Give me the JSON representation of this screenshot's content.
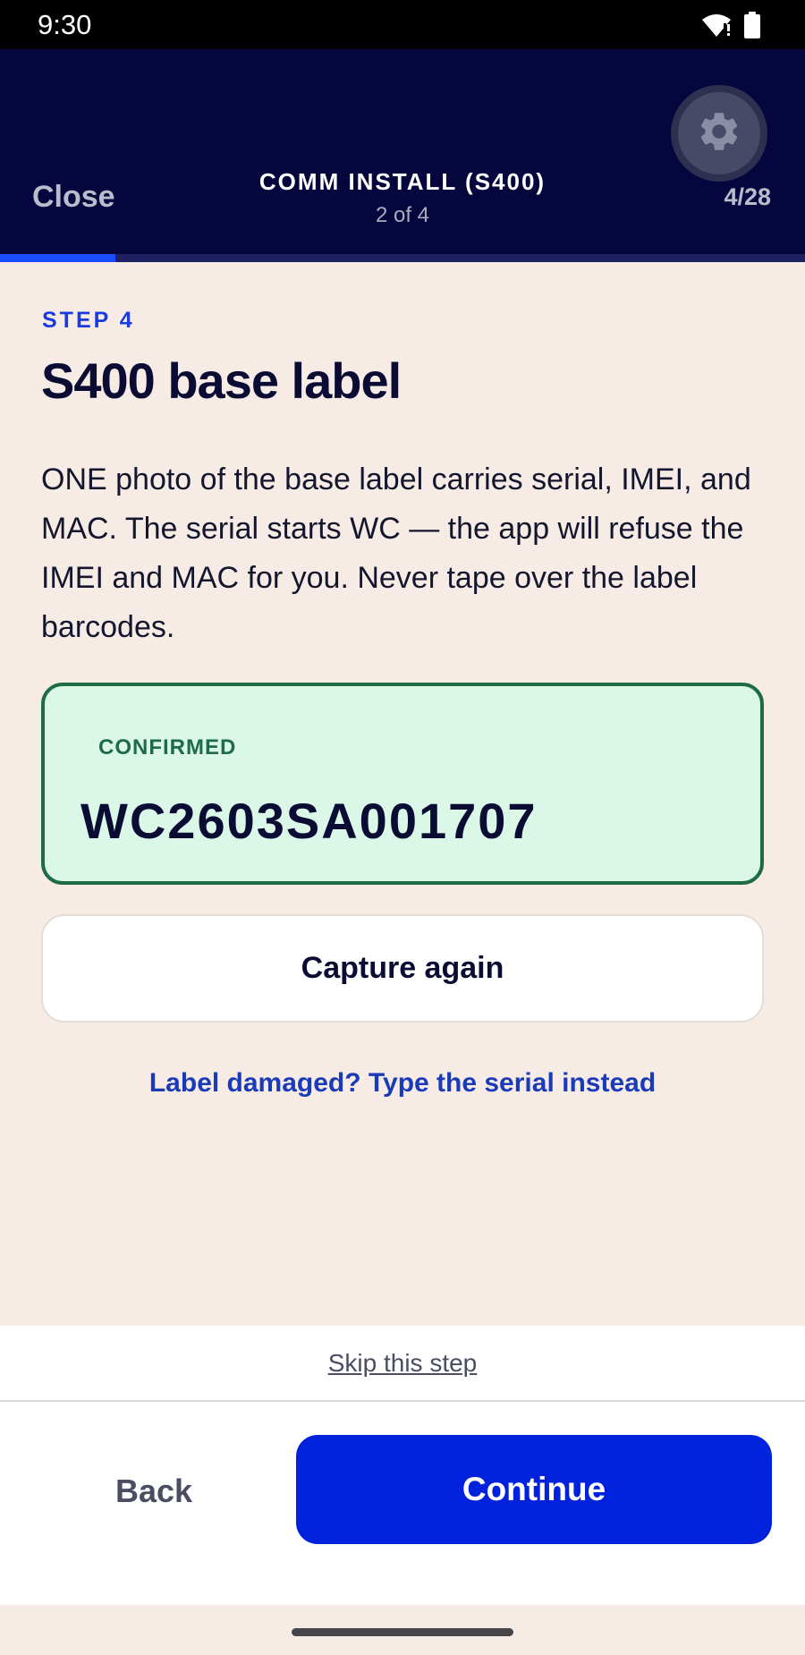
{
  "status_bar": {
    "time": "9:30",
    "icons": [
      "wifi-icon",
      "battery-icon"
    ]
  },
  "header": {
    "close_label": "Close",
    "title": "COMM INSTALL (S400)",
    "subtitle": "2 of 4",
    "step_count": "4/28",
    "settings_icon": "gear-icon",
    "progress": 0.143
  },
  "content": {
    "step_label": "STEP 4",
    "title": "S400 base label",
    "description": "ONE photo of the base label carries serial, IMEI, and MAC. The serial starts WC — the app will refuse the IMEI and MAC for you. Never tape over the label barcodes.",
    "confirmed": {
      "label": "CONFIRMED",
      "value": "WC2603SA001707"
    },
    "capture_again_label": "Capture again",
    "manual_entry_label": "Label damaged? Type the serial instead"
  },
  "footer": {
    "skip_label": "Skip this step",
    "back_label": "Back",
    "continue_label": "Continue"
  },
  "colors": {
    "header_bg": "#05063D",
    "page_bg": "#F7ECE5",
    "accent": "#0022DD",
    "confirmed_bg": "#DAF7E8",
    "confirmed_border": "#1E6B48"
  }
}
